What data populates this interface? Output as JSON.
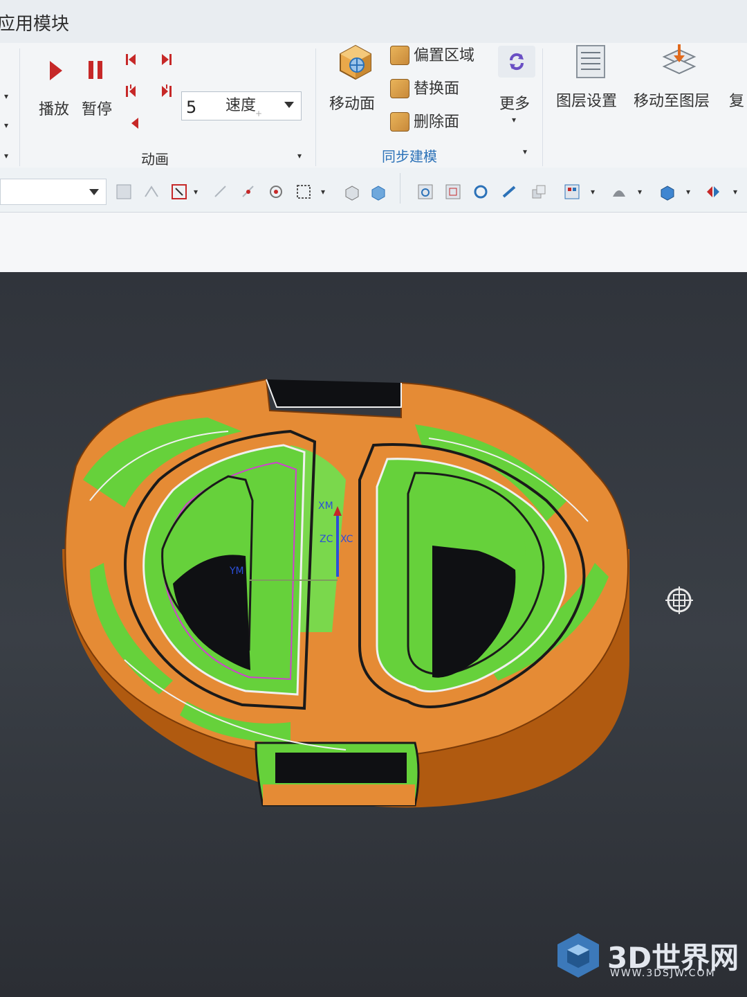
{
  "app": {
    "title": "应用模块"
  },
  "ribbon": {
    "animation": {
      "group_label": "动画",
      "play_label": "播放",
      "pause_label": "暂停",
      "speed_value": "5",
      "speed_label": "速度"
    },
    "sync_modeling": {
      "group_label": "同步建模",
      "move_face_label": "移动面",
      "offset_region_label": "偏置区域",
      "replace_face_label": "替换面",
      "delete_face_label": "删除面",
      "more_label": "更多"
    },
    "layer": {
      "layer_settings_label": "图层设置",
      "move_to_layer_label": "移动至图层",
      "copy_label_partial": "复"
    }
  },
  "viewport": {
    "triad_labels": {
      "ym": "YM",
      "xm": "XM",
      "zc": "ZC",
      "xc": "XC"
    }
  },
  "watermark": {
    "brand": "3D世界网",
    "url": "WWW.3DSJW.COM"
  },
  "colors": {
    "accent_blue": "#2c72b8",
    "play_red": "#c62828",
    "model_green": "#66d13b",
    "model_orange": "#e58b35"
  }
}
